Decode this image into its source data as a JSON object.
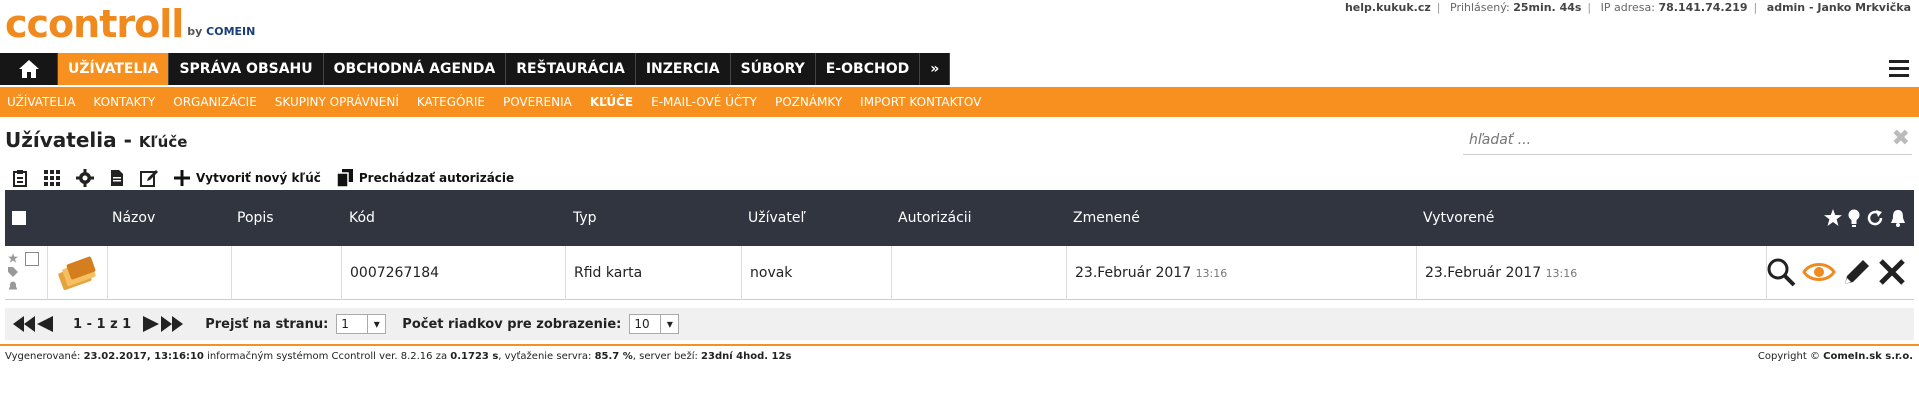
{
  "brand": {
    "name": "ccontroll",
    "by": "by",
    "company": "COMEIN"
  },
  "top_links": {
    "help": "help.kukuk.cz",
    "logged_label": "Prihlásený:",
    "logged_value": "25min. 44s",
    "ip_label": "IP adresa:",
    "ip_value": "78.141.74.219",
    "user": "admin - Janko Mrkvička"
  },
  "main_nav": {
    "items": [
      "UŽÍVATELIA",
      "SPRÁVA OBSAHU",
      "OBCHODNÁ AGENDA",
      "REŠTAURÁCIA",
      "INZERCIA",
      "SÚBORY",
      "E-OBCHOD",
      "»"
    ],
    "active_index": 0
  },
  "sub_nav": {
    "items": [
      "UŽÍVATELIA",
      "KONTAKTY",
      "ORGANIZÁCIE",
      "SKUPINY OPRÁVNENÍ",
      "KATEGÓRIE",
      "POVERENIA",
      "KĽÚČE",
      "E-MAIL-OVÉ ÚČTY",
      "POZNÁMKY",
      "IMPORT KONTAKTOV"
    ],
    "active_index": 6
  },
  "page": {
    "title": "Užívatelia",
    "dash": " - ",
    "subtitle": "Kľúče"
  },
  "search": {
    "placeholder": "hľadať ..."
  },
  "toolbar": {
    "create_label": "Vytvoriť nový kľúč",
    "browse_label": "Prechádzať autorizácie"
  },
  "table": {
    "columns": [
      "Názov",
      "Popis",
      "Kód",
      "Typ",
      "Užívateľ",
      "Autorizácii",
      "Zmenené",
      "Vytvorené"
    ],
    "rows": [
      {
        "name": "",
        "description": "",
        "code": "0007267184",
        "type": "Rfid karta",
        "user": "novak",
        "authorizations": "",
        "changed_date": "23.Február 2017",
        "changed_time": "13:16",
        "created_date": "23.Február 2017",
        "created_time": "13:16"
      }
    ]
  },
  "pager": {
    "range": "1 - 1 z 1",
    "goto_label": "Prejsť na stranu:",
    "page_value": "1",
    "rows_label": "Počet riadkov pre zobrazenie:",
    "rows_value": "10"
  },
  "footer": {
    "generated_label": "Vygenerované:",
    "generated_value": "23.02.2017, 13:16:10",
    "system_text": " informačným systémom Ccontroll ver. 8.2.16 za ",
    "time_value": "0.1723 s",
    "load_text": ", vyťaženie servra: ",
    "load_value": "85.7 %",
    "uptime_text": ", server beží: ",
    "uptime_value": "23dní 4hod. 12s",
    "copyright_label": "Copyright ©",
    "copyright_company": "ComeIn.sk s.r.o."
  },
  "colors": {
    "accent": "#f7901e",
    "nav_dark": "#161616",
    "table_header": "#303540"
  },
  "icons": [
    "home-icon",
    "menu-icon",
    "clipboard-icon",
    "grid-icon",
    "gear-icon",
    "document-icon",
    "edit-icon",
    "plus-icon",
    "copy-icon",
    "star-icon",
    "bulb-icon",
    "refresh-icon",
    "bell-icon",
    "tag-icon",
    "cards-icon",
    "search-icon",
    "eye-icon",
    "pencil-icon",
    "close-icon",
    "first-page-icon",
    "prev-page-icon",
    "next-page-icon",
    "last-page-icon"
  ]
}
